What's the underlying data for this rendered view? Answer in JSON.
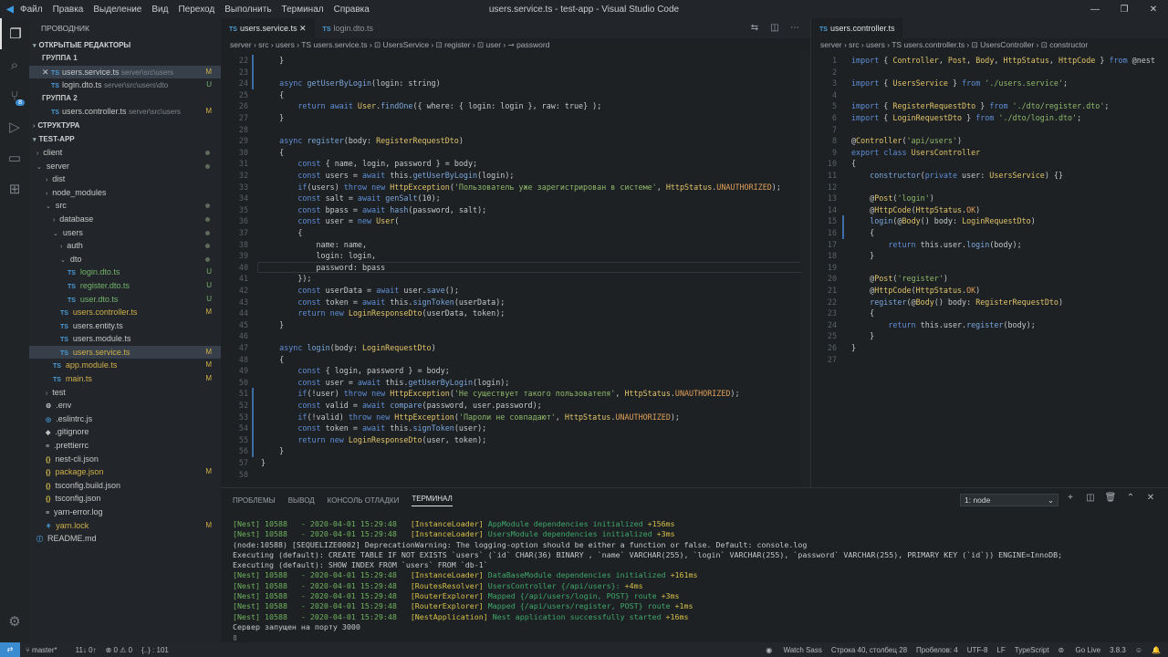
{
  "titlebar": {
    "menu": [
      "Файл",
      "Правка",
      "Выделение",
      "Вид",
      "Переход",
      "Выполнить",
      "Терминал",
      "Справка"
    ],
    "title": "users.service.ts - test-app - Visual Studio Code"
  },
  "sidebar": {
    "header": "ПРОВОДНИК",
    "open_editors": "ОТКРЫТЫЕ РЕДАКТОРЫ",
    "group1": "ГРУППА 1",
    "group2": "ГРУППА 2",
    "structure": "СТРУКТУРА",
    "project": "TEST-APP",
    "open": [
      {
        "name": "users.service.ts",
        "desc": "server\\src\\users",
        "status": "M"
      },
      {
        "name": "login.dto.ts",
        "desc": "server\\src\\users\\dto",
        "status": "U"
      },
      {
        "name": "users.controller.ts",
        "desc": "server\\src\\users",
        "status": "M"
      }
    ],
    "tree": [
      {
        "name": "client",
        "indent": 8,
        "kind": "folder-closed",
        "status": "dot"
      },
      {
        "name": "server",
        "indent": 8,
        "kind": "folder-open",
        "status": "dot"
      },
      {
        "name": "dist",
        "indent": 18,
        "kind": "folder-closed",
        "status": ""
      },
      {
        "name": "node_modules",
        "indent": 18,
        "kind": "folder-closed",
        "status": ""
      },
      {
        "name": "src",
        "indent": 18,
        "kind": "folder-open",
        "status": "dot"
      },
      {
        "name": "database",
        "indent": 26,
        "kind": "folder-closed",
        "status": "dot"
      },
      {
        "name": "users",
        "indent": 26,
        "kind": "folder-open",
        "status": "dot"
      },
      {
        "name": "auth",
        "indent": 34,
        "kind": "folder-closed",
        "status": "dot"
      },
      {
        "name": "dto",
        "indent": 34,
        "kind": "folder-open",
        "status": "dot"
      },
      {
        "name": "login.dto.ts",
        "indent": 42,
        "kind": "ts",
        "status": "U"
      },
      {
        "name": "register.dto.ts",
        "indent": 42,
        "kind": "ts",
        "status": "U"
      },
      {
        "name": "user.dto.ts",
        "indent": 42,
        "kind": "ts",
        "status": "U"
      },
      {
        "name": "users.controller.ts",
        "indent": 34,
        "kind": "ts",
        "status": "M"
      },
      {
        "name": "users.entity.ts",
        "indent": 34,
        "kind": "ts",
        "status": ""
      },
      {
        "name": "users.module.ts",
        "indent": 34,
        "kind": "ts",
        "status": ""
      },
      {
        "name": "users.service.ts",
        "indent": 34,
        "kind": "ts",
        "status": "M",
        "selected": true
      },
      {
        "name": "app.module.ts",
        "indent": 26,
        "kind": "ts",
        "status": "M"
      },
      {
        "name": "main.ts",
        "indent": 26,
        "kind": "ts",
        "status": "M"
      },
      {
        "name": "test",
        "indent": 18,
        "kind": "folder-closed",
        "status": ""
      },
      {
        "name": ".env",
        "indent": 18,
        "kind": "env",
        "status": ""
      },
      {
        "name": ".eslintrc.js",
        "indent": 18,
        "kind": "eslint",
        "status": ""
      },
      {
        "name": ".gitignore",
        "indent": 18,
        "kind": "git",
        "status": ""
      },
      {
        "name": ".prettierrc",
        "indent": 18,
        "kind": "prettier",
        "status": ""
      },
      {
        "name": "nest-cli.json",
        "indent": 18,
        "kind": "json",
        "status": ""
      },
      {
        "name": "package.json",
        "indent": 18,
        "kind": "json",
        "status": "M"
      },
      {
        "name": "tsconfig.build.json",
        "indent": 18,
        "kind": "json",
        "status": ""
      },
      {
        "name": "tsconfig.json",
        "indent": 18,
        "kind": "json",
        "status": ""
      },
      {
        "name": "yarn-error.log",
        "indent": 18,
        "kind": "log",
        "status": ""
      },
      {
        "name": "yarn.lock",
        "indent": 18,
        "kind": "yarn",
        "status": "M"
      },
      {
        "name": "README.md",
        "indent": 8,
        "kind": "md",
        "status": ""
      }
    ]
  },
  "editor1": {
    "tabs": [
      "users.service.ts",
      "login.dto.ts"
    ],
    "breadcrumb": "server › src › users › TS users.service.ts › ⊡ UsersService › ⊡ register › ⊡ user › ⊸ password",
    "lines": [
      {
        "n": "22",
        "t": "    }"
      },
      {
        "n": "23",
        "t": ""
      },
      {
        "n": "24",
        "t": "    async getUserByLogin(login: string)"
      },
      {
        "n": "25",
        "t": "    {"
      },
      {
        "n": "26",
        "t": "        return await User.findOne({ where: { login: login }, raw: true} );"
      },
      {
        "n": "27",
        "t": "    }"
      },
      {
        "n": "28",
        "t": ""
      },
      {
        "n": "29",
        "t": "    async register(body: RegisterRequestDto)"
      },
      {
        "n": "30",
        "t": "    {"
      },
      {
        "n": "31",
        "t": "        const { name, login, password } = body;"
      },
      {
        "n": "32",
        "t": "        const users = await this.getUserByLogin(login);"
      },
      {
        "n": "33",
        "t": "        if(users) throw new HttpException('Пользователь уже зарегистрирован в системе', HttpStatus.UNAUTHORIZED);"
      },
      {
        "n": "34",
        "t": "        const salt = await genSalt(10);"
      },
      {
        "n": "35",
        "t": "        const bpass = await hash(password, salt);"
      },
      {
        "n": "36",
        "t": "        const user = new User("
      },
      {
        "n": "37",
        "t": "        {"
      },
      {
        "n": "38",
        "t": "            name: name,"
      },
      {
        "n": "39",
        "t": "            login: login,"
      },
      {
        "n": "40",
        "t": "            password: bpass"
      },
      {
        "n": "41",
        "t": "        });"
      },
      {
        "n": "42",
        "t": "        const userData = await user.save();"
      },
      {
        "n": "43",
        "t": "        const token = await this.signToken(userData);"
      },
      {
        "n": "44",
        "t": "        return new LoginResponseDto(userData, token);"
      },
      {
        "n": "45",
        "t": "    }"
      },
      {
        "n": "46",
        "t": ""
      },
      {
        "n": "47",
        "t": "    async login(body: LoginRequestDto)"
      },
      {
        "n": "48",
        "t": "    {"
      },
      {
        "n": "49",
        "t": "        const { login, password } = body;"
      },
      {
        "n": "50",
        "t": "        const user = await this.getUserByLogin(login);"
      },
      {
        "n": "51",
        "t": "        if(!user) throw new HttpException('Не существует такого пользователя', HttpStatus.UNAUTHORIZED);"
      },
      {
        "n": "52",
        "t": "        const valid = await compare(password, user.password);"
      },
      {
        "n": "53",
        "t": "        if(!valid) throw new HttpException('Пароли не совпадают', HttpStatus.UNAUTHORIZED);"
      },
      {
        "n": "54",
        "t": "        const token = await this.signToken(user);"
      },
      {
        "n": "55",
        "t": "        return new LoginResponseDto(user, token);"
      },
      {
        "n": "56",
        "t": "    }"
      },
      {
        "n": "57",
        "t": "}"
      },
      {
        "n": "58",
        "t": ""
      }
    ]
  },
  "editor2": {
    "tabs": [
      "users.controller.ts"
    ],
    "breadcrumb": "server › src › users › TS users.controller.ts › ⊡ UsersController › ⊡ constructor",
    "lines": [
      {
        "n": "1",
        "t": "import { Controller, Post, Body, HttpStatus, HttpCode } from '@nest"
      },
      {
        "n": "2",
        "t": ""
      },
      {
        "n": "3",
        "t": "import { UsersService } from './users.service';"
      },
      {
        "n": "4",
        "t": ""
      },
      {
        "n": "5",
        "t": "import { RegisterRequestDto } from './dto/register.dto';"
      },
      {
        "n": "6",
        "t": "import { LoginRequestDto } from './dto/login.dto';"
      },
      {
        "n": "7",
        "t": ""
      },
      {
        "n": "8",
        "t": "@Controller('api/users')"
      },
      {
        "n": "9",
        "t": "export class UsersController"
      },
      {
        "n": "10",
        "t": "{"
      },
      {
        "n": "11",
        "t": "    constructor(private user: UsersService) {}"
      },
      {
        "n": "12",
        "t": ""
      },
      {
        "n": "13",
        "t": "    @Post('login')"
      },
      {
        "n": "14",
        "t": "    @HttpCode(HttpStatus.OK)"
      },
      {
        "n": "15",
        "t": "    login(@Body() body: LoginRequestDto)"
      },
      {
        "n": "16",
        "t": "    {"
      },
      {
        "n": "17",
        "t": "        return this.user.login(body);"
      },
      {
        "n": "18",
        "t": "    }"
      },
      {
        "n": "19",
        "t": ""
      },
      {
        "n": "20",
        "t": "    @Post('register')"
      },
      {
        "n": "21",
        "t": "    @HttpCode(HttpStatus.OK)"
      },
      {
        "n": "22",
        "t": "    register(@Body() body: RegisterRequestDto)"
      },
      {
        "n": "23",
        "t": "    {"
      },
      {
        "n": "24",
        "t": "        return this.user.register(body);"
      },
      {
        "n": "25",
        "t": "    }"
      },
      {
        "n": "26",
        "t": "}"
      },
      {
        "n": "27",
        "t": ""
      }
    ]
  },
  "panel": {
    "tabs": [
      "ПРОБЛЕМЫ",
      "ВЫВОД",
      "КОНСОЛЬ ОТЛАДКИ",
      "ТЕРМИНАЛ"
    ],
    "terminal_select": "1: node",
    "terminal": [
      "[Nest] 10588   - 2020-04-01 15:29:48   [InstanceLoader] AppModule dependencies initialized +156ms",
      "[Nest] 10588   - 2020-04-01 15:29:48   [InstanceLoader] UsersModule dependencies initialized +3ms",
      "(node:10588) [SEQUELIZE0002] DeprecationWarning: The logging-option should be either a function or false. Default: console.log",
      "Executing (default): CREATE TABLE IF NOT EXISTS `users` (`id` CHAR(36) BINARY , `name` VARCHAR(255), `login` VARCHAR(255), `password` VARCHAR(255), PRIMARY KEY (`id`)) ENGINE=InnoDB;",
      "Executing (default): SHOW INDEX FROM `users` FROM `db-1`",
      "[Nest] 10588   - 2020-04-01 15:29:48   [InstanceLoader] DataBaseModule dependencies initialized +161ms",
      "[Nest] 10588   - 2020-04-01 15:29:48   [RoutesResolver] UsersController {/api/users}: +4ms",
      "[Nest] 10588   - 2020-04-01 15:29:48   [RouterExplorer] Mapped {/api/users/login, POST} route +3ms",
      "[Nest] 10588   - 2020-04-01 15:29:48   [RouterExplorer] Mapped {/api/users/register, POST} route +1ms",
      "[Nest] 10588   - 2020-04-01 15:29:48   [NestApplication] Nest application successfully started +16ms",
      "Сервер запущен на порту 3000",
      "▯"
    ]
  },
  "statusbar": {
    "branch": "master*",
    "sync": "11↓ 0↑",
    "problems": "⊗ 0 ⚠ 0",
    "selection": "{..} : 101",
    "watch": "Watch Sass",
    "position": "Строка 40, столбец 28",
    "spaces": "Пробелов: 4",
    "encoding": "UTF-8",
    "eol": "LF",
    "language": "TypeScript",
    "golive": "Go Live",
    "version": "3.8.3"
  }
}
